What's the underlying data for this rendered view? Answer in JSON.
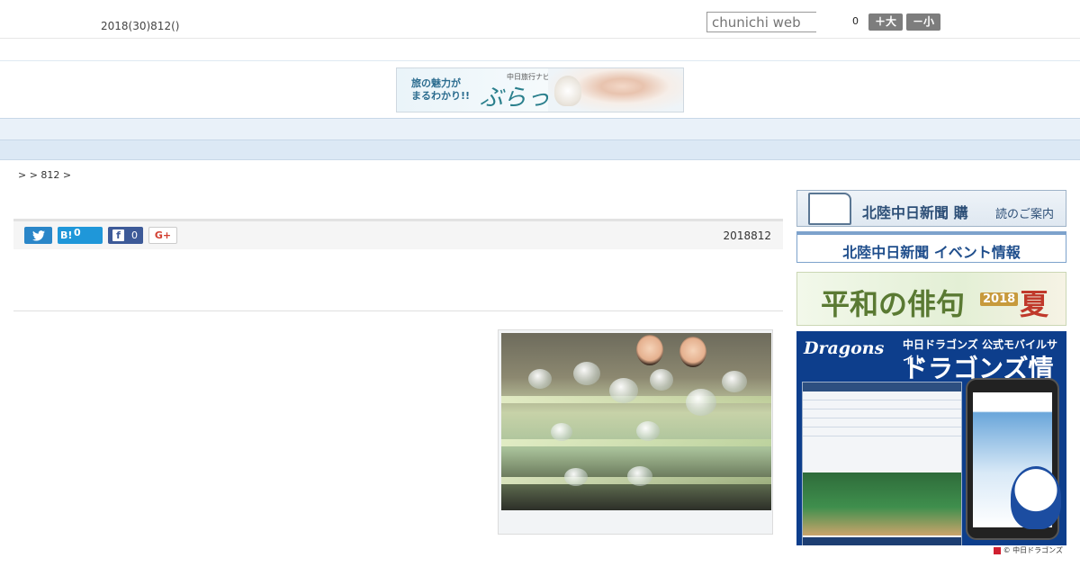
{
  "header": {
    "date": "2018(30)812()",
    "search_placeholder": "chunichi web",
    "font_size_count": "0",
    "font_larger": "＋大",
    "font_smaller": "－小"
  },
  "banner": {
    "left_text_1": "旅の魅力が",
    "left_text_2": "まるわかり!!",
    "sub": "中日旅行ナビ",
    "main": "ぶらっ人"
  },
  "nav": {
    "items": [
      "",
      "",
      "",
      "",
      "",
      "",
      "",
      "",
      ""
    ]
  },
  "breadcrumb": ">  > 812 >",
  "article": {
    "twitter_label": "",
    "hatena_mark": "B!",
    "hatena_count": "0",
    "facebook_mark": "f",
    "facebook_count": "0",
    "gplus_label": "G+",
    "date": "2018812"
  },
  "sidebar": {
    "subscribe_main": "北陸中日新聞 購",
    "subscribe_tail": "読のご案内",
    "event": "北陸中日新聞 イベント情報",
    "haiku_main": "平和の俳句",
    "haiku_year": "2018",
    "haiku_season": "夏",
    "dragons_logo": "Dragons",
    "dragons_sub": "中日ドラゴンズ 公式モバイルサイト",
    "dragons_big": "ドラゴンズ情報",
    "dragons_footer": "© 中日ドラゴンズ"
  }
}
